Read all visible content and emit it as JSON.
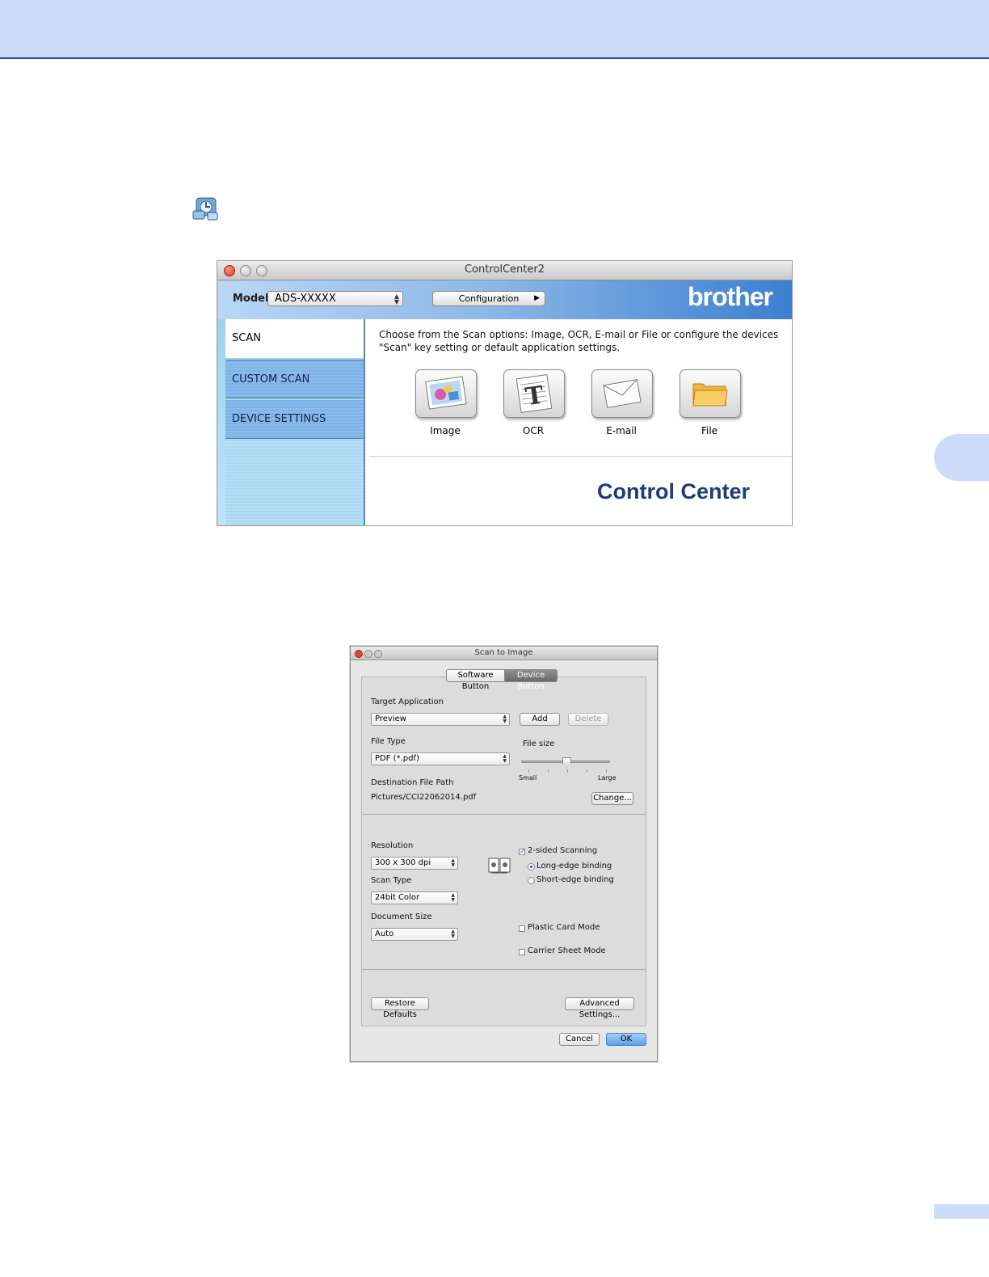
{
  "controlcenter": {
    "window_title": "ControlCenter2",
    "model_label": "Model",
    "model_value": "ADS-XXXXX",
    "configuration_label": "Configuration",
    "brand": "brother",
    "sidebar": [
      {
        "label": "SCAN"
      },
      {
        "label": "CUSTOM SCAN"
      },
      {
        "label": "DEVICE SETTINGS"
      }
    ],
    "description": "Choose from the Scan options: Image, OCR, E-mail or File or configure the devices \"Scan\" key setting or default application settings.",
    "scan_buttons": [
      {
        "label": "Image",
        "icon": "image-icon"
      },
      {
        "label": "OCR",
        "icon": "ocr-icon"
      },
      {
        "label": "E-mail",
        "icon": "envelope-icon"
      },
      {
        "label": "File",
        "icon": "folder-icon"
      }
    ],
    "logo_text": "Control Center"
  },
  "dialog": {
    "title": "Scan to Image",
    "tabs": [
      "Software Button",
      "Device Button"
    ],
    "active_tab": "Device Button",
    "target_application_label": "Target Application",
    "target_application_value": "Preview",
    "add_label": "Add",
    "delete_label": "Delete",
    "file_type_label": "File Type",
    "file_type_value": "PDF (*.pdf)",
    "file_size_label": "File size",
    "file_size_small": "Small",
    "file_size_large": "Large",
    "destination_label": "Destination File Path",
    "destination_value": "Pictures/CCI22062014.pdf",
    "change_label": "Change...",
    "resolution_label": "Resolution",
    "resolution_value": "300 x 300 dpi",
    "scan_type_label": "Scan Type",
    "scan_type_value": "24bit Color",
    "document_size_label": "Document Size",
    "document_size_value": "Auto",
    "two_sided_label": "2-sided Scanning",
    "two_sided_checked": true,
    "long_edge_label": "Long-edge binding",
    "short_edge_label": "Short-edge binding",
    "binding_selected": "Long-edge binding",
    "plastic_card_label": "Plastic Card Mode",
    "carrier_sheet_label": "Carrier Sheet Mode",
    "restore_defaults_label": "Restore Defaults",
    "advanced_settings_label": "Advanced Settings...",
    "cancel_label": "Cancel",
    "ok_label": "OK"
  }
}
